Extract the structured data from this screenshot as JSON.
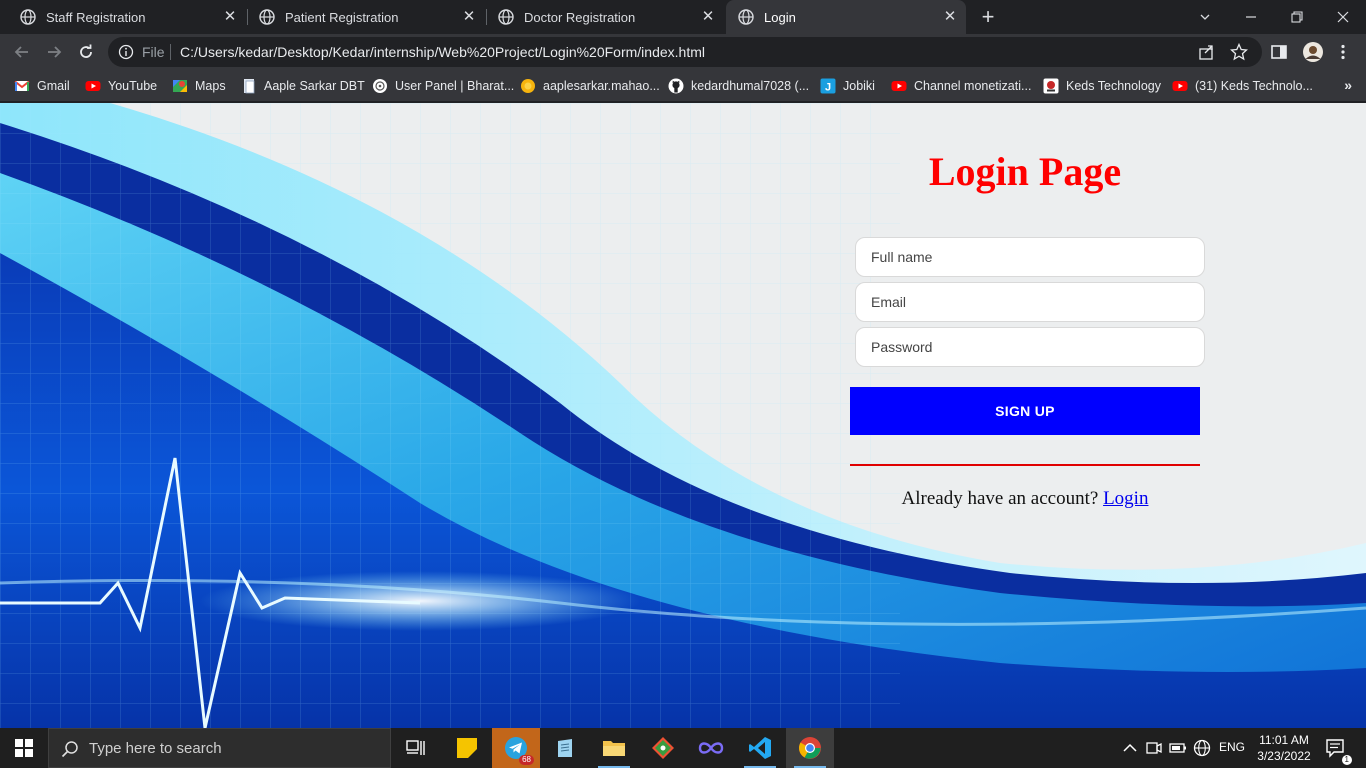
{
  "browser": {
    "tabs": [
      {
        "label": "Staff Registration",
        "active": false
      },
      {
        "label": "Patient Registration",
        "active": false
      },
      {
        "label": "Doctor Registration",
        "active": false
      },
      {
        "label": "Login",
        "active": true
      }
    ],
    "address": {
      "scheme_label": "File",
      "url": "C:/Users/kedar/Desktop/Kedar/internship/Web%20Project/Login%20Form/index.html"
    },
    "bookmarks": [
      {
        "label": "Gmail",
        "icon": "gmail-icon"
      },
      {
        "label": "YouTube",
        "icon": "youtube-icon"
      },
      {
        "label": "Maps",
        "icon": "maps-icon"
      },
      {
        "label": "Aaple Sarkar DBT",
        "icon": "page-icon"
      },
      {
        "label": "User Panel | Bharat...",
        "icon": "emblem-icon"
      },
      {
        "label": "aaplesarkar.mahao...",
        "icon": "sun-icon"
      },
      {
        "label": "kedardhumal7028 (...",
        "icon": "github-icon"
      },
      {
        "label": "Jobiki",
        "icon": "jobiki-icon"
      },
      {
        "label": "Channel monetizati...",
        "icon": "youtube-icon"
      },
      {
        "label": "Keds Technology",
        "icon": "keds-icon"
      },
      {
        "label": "(31) Keds Technolo...",
        "icon": "youtube-icon"
      }
    ]
  },
  "page": {
    "title": "Login Page",
    "fields": {
      "fullname_placeholder": "Full name",
      "email_placeholder": "Email",
      "password_placeholder": "Password"
    },
    "signup_label": "SIGN UP",
    "account_prompt": "Already have an account?",
    "login_link": "Login",
    "colors": {
      "title": "#ff0000",
      "button": "#0000ff",
      "divider": "#e00000"
    }
  },
  "taskbar": {
    "search_placeholder": "Type here to search",
    "telegram_badge": "68",
    "language": "ENG",
    "time": "11:01 AM",
    "date": "3/23/2022",
    "notification_count": "1"
  }
}
